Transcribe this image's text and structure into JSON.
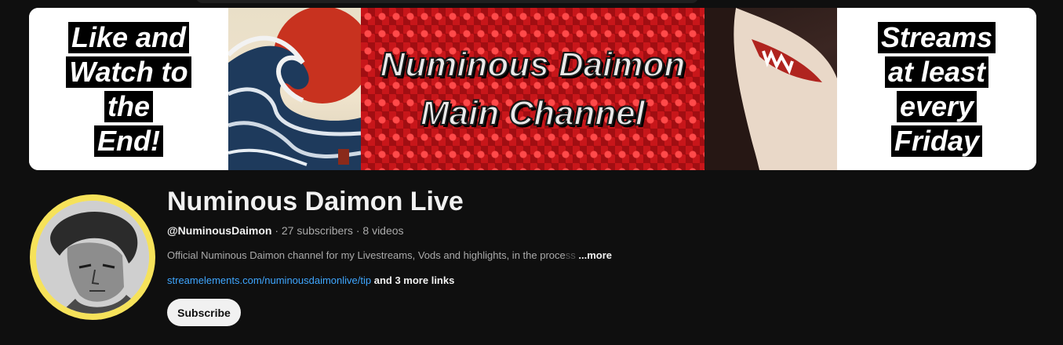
{
  "banner": {
    "left_lines": [
      "Like and",
      "Watch to",
      "the",
      "End!"
    ],
    "center_lines": [
      "Numinous Daimon",
      "Main Channel"
    ],
    "right_lines": [
      "Streams",
      "at least",
      "every",
      "Friday"
    ]
  },
  "channel": {
    "title": "Numinous Daimon Live",
    "handle": "@NuminousDaimon",
    "separator": " · ",
    "subscribers": "27 subscribers",
    "videos": "8 videos",
    "description": "Official Numinous Daimon channel for my Livestreams, Vods and highlights, in the proce",
    "description_fade": "ss",
    "more_label": "...more",
    "link_url": "streamelements.com/numinousdaimonlive/tip",
    "more_links": " and 3 more links",
    "subscribe_label": "Subscribe"
  },
  "colors": {
    "background": "#0f0f0f",
    "link": "#3ea6ff",
    "banner_red": "#c8161a",
    "avatar_ring": "#f6e25a"
  }
}
